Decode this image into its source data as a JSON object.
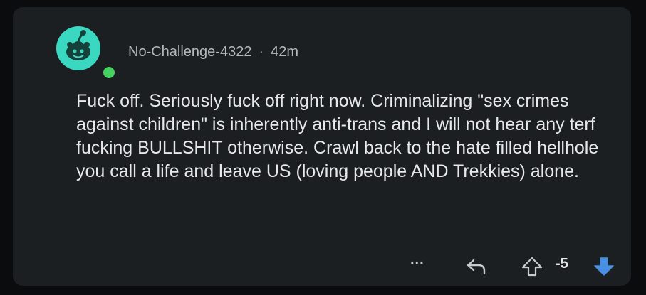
{
  "comment": {
    "username": "No-Challenge-4322",
    "separator": "·",
    "age": "42m",
    "body": "Fuck off. Seriously fuck off right now. Criminalizing \"sex crimes against children\" is inherently anti-trans and I will not hear any terf fucking BULLSHIT otherwise. Crawl back to the hate filled hellhole you call a life and leave US (loving people AND Trekkies) alone.",
    "score": "-5",
    "more_label": "...",
    "vote_state": "downvoted"
  },
  "icons": {
    "avatar": "snoo-avatar-icon",
    "online": "online-status-icon",
    "more": "more-options-icon",
    "reply": "reply-icon",
    "upvote": "upvote-icon",
    "downvote": "downvote-icon"
  },
  "colors": {
    "background": "#1c1f22",
    "text": "#e6e8ea",
    "meta": "#b5b9bd",
    "avatar": "#3ad7c1",
    "online": "#46d160",
    "downvote_active": "#4a90e2"
  }
}
